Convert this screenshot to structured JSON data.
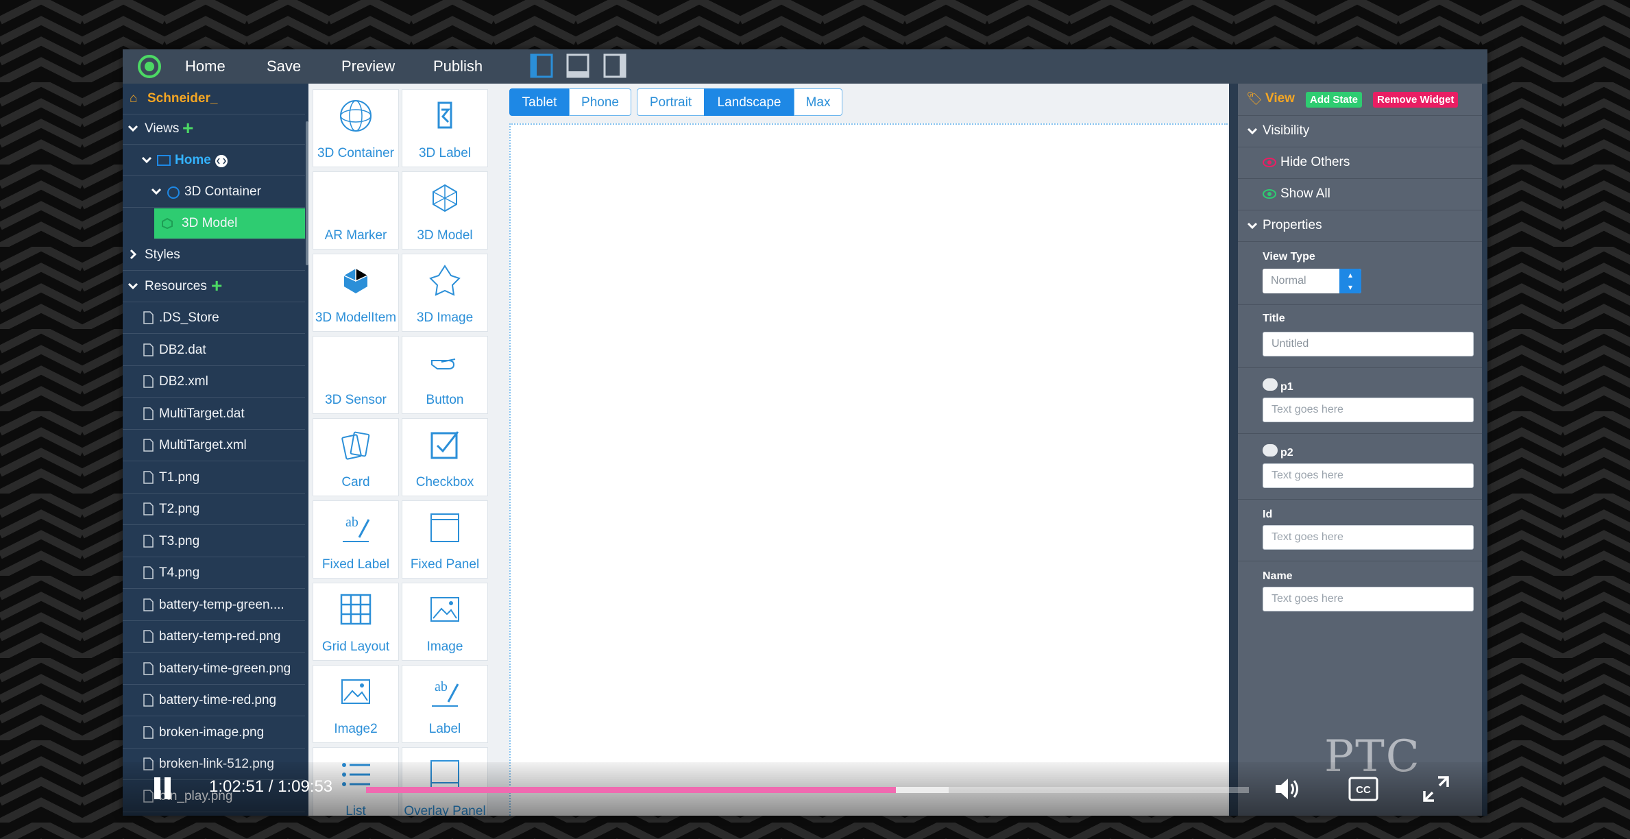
{
  "topbar": {
    "nav": [
      "Home",
      "Save",
      "Preview",
      "Publish"
    ]
  },
  "tree": {
    "project": "Schneider_",
    "views_label": "Views",
    "home_label": "Home",
    "container_label": "3D Container",
    "model_label": "3D Model",
    "styles_label": "Styles",
    "resources_label": "Resources",
    "files": [
      ".DS_Store",
      "DB2.dat",
      "DB2.xml",
      "MultiTarget.dat",
      "MultiTarget.xml",
      "T1.png",
      "T2.png",
      "T3.png",
      "T4.png",
      "battery-temp-green....",
      "battery-temp-red.png",
      "battery-time-green.png",
      "battery-time-red.png",
      "broken-image.png",
      "broken-link-512.png",
      "btn_play.png"
    ]
  },
  "palette": {
    "widgets": [
      {
        "label": "3D Container",
        "icon": "3d-container-icon"
      },
      {
        "label": "3D Label",
        "icon": "3d-label-icon"
      },
      {
        "label": "AR Marker",
        "icon": ""
      },
      {
        "label": "3D Model",
        "icon": "3d-model-icon"
      },
      {
        "label": "3D ModelItem",
        "icon": "3d-model-item-icon"
      },
      {
        "label": "3D Image",
        "icon": "3d-image-icon"
      },
      {
        "label": "3D Sensor",
        "icon": ""
      },
      {
        "label": "Button",
        "icon": "button-hand-icon"
      },
      {
        "label": "Card",
        "icon": "card-icon"
      },
      {
        "label": "Checkbox",
        "icon": "checkbox-icon"
      },
      {
        "label": "Fixed Label",
        "icon": "fixed-label-icon"
      },
      {
        "label": "Fixed Panel",
        "icon": "fixed-panel-icon"
      },
      {
        "label": "Grid Layout",
        "icon": "grid-layout-icon"
      },
      {
        "label": "Image",
        "icon": "image-icon"
      },
      {
        "label": "Image2",
        "icon": "image2-icon"
      },
      {
        "label": "Label",
        "icon": "label-icon"
      },
      {
        "label": "List",
        "icon": "list-icon"
      },
      {
        "label": "Overlay Panel",
        "icon": "overlay-panel-icon"
      }
    ]
  },
  "canvas": {
    "device_buttons": [
      "Tablet",
      "Phone"
    ],
    "orientation_buttons": [
      "Portrait",
      "Landscape",
      "Max"
    ],
    "selected_device": "Tablet",
    "selected_orientation": "Landscape"
  },
  "right": {
    "view_label": "View",
    "add_state": "Add State",
    "remove_widget": "Remove Widget",
    "visibility": "Visibility",
    "hide_others": "Hide Others",
    "show_all": "Show All",
    "properties": "Properties",
    "view_type_label": "View Type",
    "view_type_value": "Normal",
    "title_label": "Title",
    "title_value": "Untitled",
    "p1_label": "p1",
    "p1_placeholder": "Text goes here",
    "p2_label": "p2",
    "p2_placeholder": "Text goes here",
    "id_label": "Id",
    "id_placeholder": "Text goes here",
    "name_label": "Name",
    "name_placeholder": "Text goes here"
  },
  "player": {
    "time": "1:02:51  /  1:09:53",
    "progress_fraction": 0.6,
    "buffer_fraction": 0.66,
    "watermark": "PTC",
    "accent_color": "#f06ab0"
  }
}
